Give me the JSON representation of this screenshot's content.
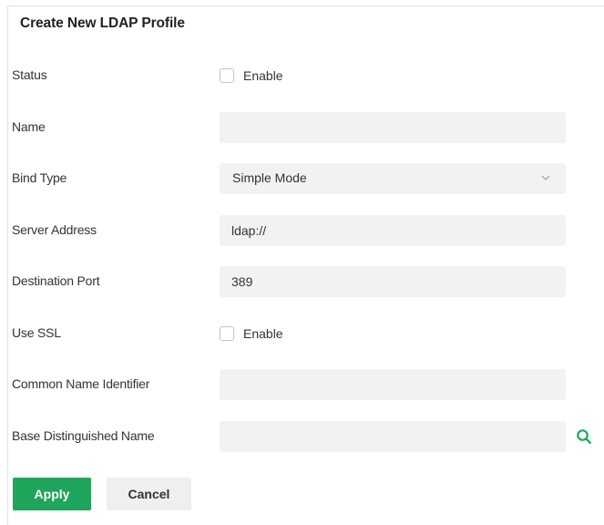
{
  "panel": {
    "title": "Create New LDAP Profile"
  },
  "form": {
    "status": {
      "label": "Status",
      "checkbox_label": "Enable",
      "checked": false
    },
    "name": {
      "label": "Name",
      "value": ""
    },
    "bind_type": {
      "label": "Bind Type",
      "value": "Simple Mode",
      "icon": "chevron-down-icon"
    },
    "server_address": {
      "label": "Server Address",
      "value": "ldap://"
    },
    "destination_port": {
      "label": "Destination Port",
      "value": "389"
    },
    "use_ssl": {
      "label": "Use SSL",
      "checkbox_label": "Enable",
      "checked": false
    },
    "common_name_identifier": {
      "label": "Common Name Identifier",
      "value": ""
    },
    "base_dn": {
      "label": "Base Distinguished Name",
      "value": "",
      "icon": "search-icon"
    }
  },
  "actions": {
    "apply_label": "Apply",
    "cancel_label": "Cancel"
  },
  "colors": {
    "accent": "#1fa55c",
    "input_bg": "#f2f2f2",
    "cancel_bg": "#efefef"
  }
}
